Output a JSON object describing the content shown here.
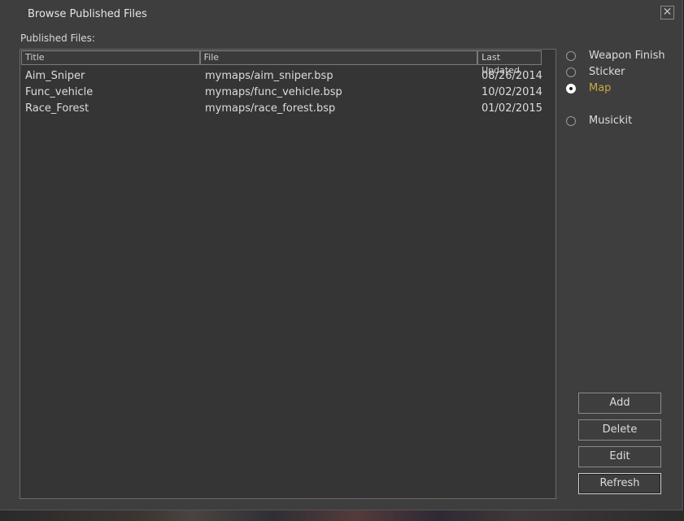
{
  "window": {
    "title": "Browse Published Files",
    "close_icon": "close-icon"
  },
  "list": {
    "label": "Published Files:",
    "columns": [
      "Title",
      "File",
      "Last Updated"
    ],
    "rows": [
      {
        "title": "Aim_Sniper",
        "file": "mymaps/aim_sniper.bsp",
        "updated": "08/26/2014"
      },
      {
        "title": "Func_vehicle",
        "file": "mymaps/func_vehicle.bsp",
        "updated": "10/02/2014"
      },
      {
        "title": "Race_Forest",
        "file": "mymaps/race_forest.bsp",
        "updated": "01/02/2015"
      }
    ]
  },
  "filters": {
    "options": [
      {
        "label": "Weapon Finish",
        "selected": false
      },
      {
        "label": "Sticker",
        "selected": false
      },
      {
        "label": "Map",
        "selected": true
      },
      {
        "label": "Musickit",
        "selected": false
      }
    ],
    "selected_color": "#c8a943"
  },
  "buttons": {
    "add": "Add",
    "delete": "Delete",
    "edit": "Edit",
    "refresh": "Refresh"
  }
}
